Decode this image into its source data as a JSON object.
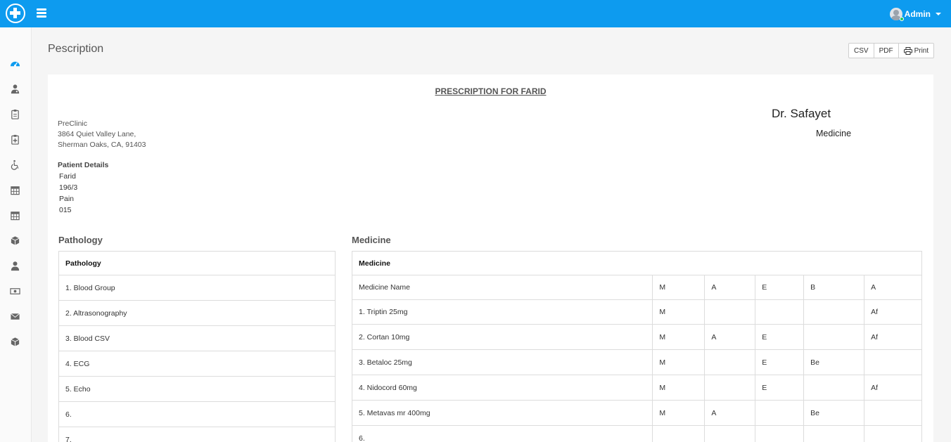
{
  "header": {
    "user": "Admin"
  },
  "page": {
    "title": "Pescription"
  },
  "toolbar": {
    "csv": "CSV",
    "pdf": "PDF",
    "print": "Print"
  },
  "prescription": {
    "title": "PRESCRIPTION FOR FARID",
    "clinic": {
      "name": "PreClinic",
      "address1": "3864 Quiet Valley Lane,",
      "address2": "Sherman Oaks, CA, 91403"
    },
    "doctor": {
      "name": "Dr. Safayet",
      "speciality": "Medicine"
    },
    "patient": {
      "label": "Patient Details",
      "details": [
        "Farid",
        "196/3",
        "Pain",
        "015"
      ]
    }
  },
  "pathology": {
    "section_title": "Pathology",
    "header": "Pathology",
    "items": [
      "1. Blood Group",
      "2. Altrasonography",
      "3. Blood CSV",
      "4. ECG",
      "5. Echo",
      "6.",
      "7."
    ]
  },
  "medicine": {
    "section_title": "Medicine",
    "header": "Medicine",
    "columns": [
      "Medicine Name",
      "M",
      "A",
      "E",
      "B",
      "A"
    ],
    "rows": [
      [
        "1. Triptin 25mg",
        "M",
        "",
        "",
        "",
        "Af"
      ],
      [
        "2. Cortan 10mg",
        "M",
        "A",
        "E",
        "",
        "Af"
      ],
      [
        "3. Betaloc 25mg",
        "M",
        "",
        "E",
        "Be",
        ""
      ],
      [
        "4. Nidocord 60mg",
        "M",
        "",
        "E",
        "",
        "Af"
      ],
      [
        "5. Metavas mr 400mg",
        "M",
        "A",
        "",
        "Be",
        ""
      ],
      [
        "6.",
        "",
        "",
        "",
        "",
        ""
      ]
    ]
  },
  "colors": {
    "accent": "#0d9bef",
    "online": "#22c55e"
  }
}
